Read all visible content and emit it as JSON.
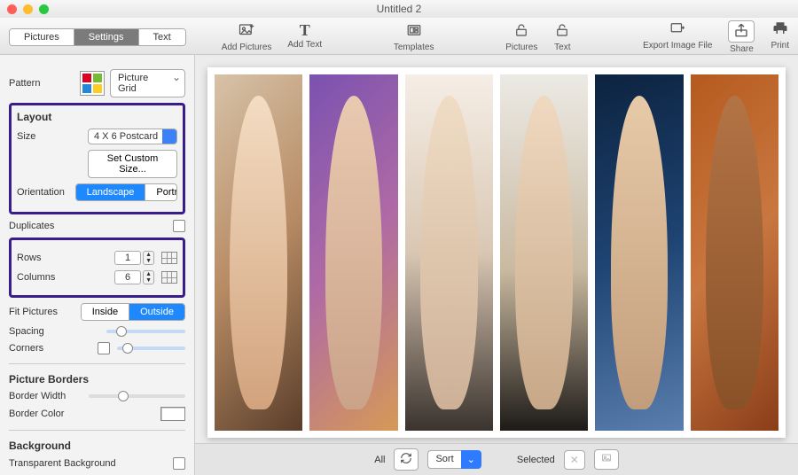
{
  "window": {
    "title": "Untitled 2"
  },
  "tabs": {
    "pictures": "Pictures",
    "settings": "Settings",
    "text": "Text",
    "active": "Settings"
  },
  "toolbar": {
    "add_pictures": "Add Pictures",
    "add_text": "Add Text",
    "templates": "Templates",
    "pictures": "Pictures",
    "text": "Text",
    "export": "Export Image File",
    "share": "Share",
    "print": "Print"
  },
  "pattern": {
    "label": "Pattern",
    "value": "Picture Grid"
  },
  "layout": {
    "heading": "Layout",
    "size_label": "Size",
    "size_value": "4 X 6 Postcard",
    "custom_size": "Set Custom Size...",
    "orientation_label": "Orientation",
    "orientation_landscape": "Landscape",
    "orientation_portrait": "Portrait",
    "orientation_selected": "Landscape"
  },
  "duplicates": {
    "label": "Duplicates",
    "checked": false
  },
  "grid": {
    "rows_label": "Rows",
    "rows": "1",
    "columns_label": "Columns",
    "columns": "6"
  },
  "fit": {
    "label": "Fit Pictures",
    "inside": "Inside",
    "outside": "Outside",
    "selected": "Outside"
  },
  "spacing": {
    "label": "Spacing",
    "value_pct": 12
  },
  "corners": {
    "label": "Corners",
    "checked": false,
    "value_pct": 8
  },
  "borders": {
    "heading": "Picture Borders",
    "width_label": "Border Width",
    "width_pct": 30,
    "color_label": "Border Color",
    "color": "#ffffff"
  },
  "background": {
    "heading": "Background",
    "transparent_label": "Transparent Background",
    "transparent": false
  },
  "bottombar": {
    "all": "All",
    "sort": "Sort",
    "selected": "Selected"
  }
}
